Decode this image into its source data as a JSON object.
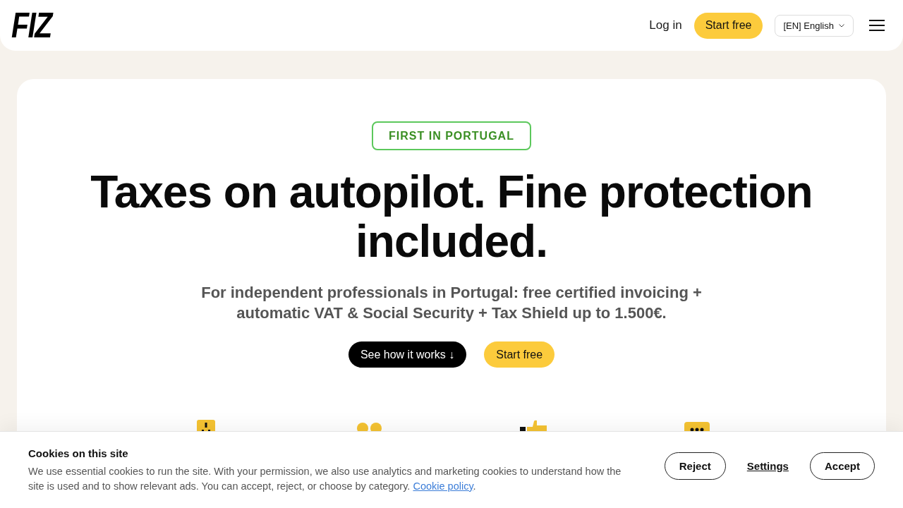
{
  "header": {
    "logo": "FIZ",
    "login": "Log in",
    "cta": "Start free",
    "language": "[EN] English"
  },
  "hero": {
    "badge": "FIRST IN PORTUGAL",
    "title": "Taxes on autopilot. Fine protection included.",
    "subtitle": "For independent professionals in Portugal: free certified invoicing + automatic VAT & Social Security + Tax Shield up to 1.500€.",
    "buttons": [
      {
        "label": "See how it works ↓",
        "kind": "dark"
      },
      {
        "label": "Start free",
        "kind": "accent"
      }
    ]
  },
  "cookie_banner": {
    "title": "Cookies on this site",
    "text": "We use essential cookies to run the site. With your permission, we also use analytics and marketing cookies to understand how the site is used and to show relevant ads. You can accept, reject, or choose by category.",
    "link": "Cookie policy",
    "after_link": ".",
    "buttons": [
      {
        "label": "Reject",
        "kind": "outline"
      },
      {
        "label": "Settings",
        "kind": "link"
      },
      {
        "label": "Accept",
        "kind": "outline"
      }
    ]
  }
}
